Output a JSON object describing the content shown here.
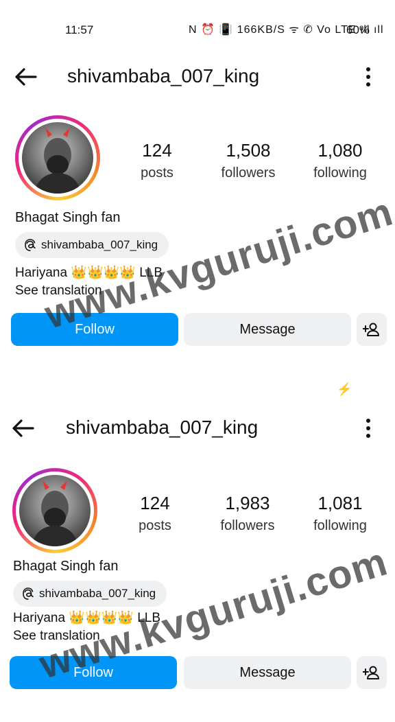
{
  "status_bar": {
    "time": "11:57",
    "icons_text": "N ⏰ 📳 166KB/S ᯤ ✆ Vo LTE ıll ıll",
    "battery": "60%"
  },
  "profiles": [
    {
      "username": "shivambaba_007_king",
      "stats": [
        {
          "value": "124",
          "label": "posts"
        },
        {
          "value": "1,508",
          "label": "followers"
        },
        {
          "value": "1,080",
          "label": "following"
        }
      ],
      "bio_name": "Bhagat Singh fan",
      "threads_handle": "shivambaba_007_king",
      "bio_line": "Hariyana 👑👑👑👑 LLB",
      "see_translation": "See translation",
      "follow_label": "Follow",
      "message_label": "Message"
    },
    {
      "username": "shivambaba_007_king",
      "stats": [
        {
          "value": "124",
          "label": "posts"
        },
        {
          "value": "1,983",
          "label": "followers"
        },
        {
          "value": "1,081",
          "label": "following"
        }
      ],
      "bio_name": "Bhagat Singh fan",
      "threads_handle": "shivambaba_007_king",
      "bio_line": "Hariyana 👑👑👑👑 LLB",
      "see_translation": "See translation",
      "follow_label": "Follow",
      "message_label": "Message"
    }
  ],
  "watermark": "www.kvguruji.com",
  "colors": {
    "follow_blue": "#0095f6",
    "secondary_button": "#eff0f2",
    "accent_bolt": "#3d5afe"
  }
}
